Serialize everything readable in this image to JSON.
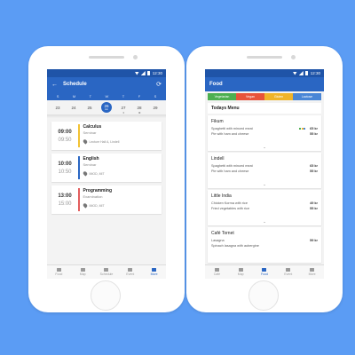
{
  "status": {
    "time": "12:30"
  },
  "schedule": {
    "title": "Schedule",
    "weekdays": [
      "S",
      "M",
      "T",
      "W",
      "T",
      "F",
      "S"
    ],
    "dates": [
      "23",
      "24",
      "25",
      "26",
      "27",
      "28",
      "29"
    ],
    "selected_sub": "Jun",
    "events": [
      {
        "start": "09:00",
        "end": "09:50",
        "subject": "Calculus",
        "kind": "Seminar",
        "location": "Lecture Hall A, Lindell",
        "color": "#f2c233"
      },
      {
        "start": "10:00",
        "end": "10:50",
        "subject": "English",
        "kind": "Seminar",
        "location": "IMOD, MIT",
        "color": "#2a66c3"
      },
      {
        "start": "13:00",
        "end": "15:00",
        "subject": "Programming",
        "kind": "Examination",
        "location": "IMOD, MIT",
        "color": "#e35d5d"
      }
    ]
  },
  "food": {
    "title": "Food",
    "tags": [
      {
        "label": "Vegetarian",
        "color": "#4caf50"
      },
      {
        "label": "Vegan",
        "color": "#e8533a"
      },
      {
        "label": "Gluten",
        "color": "#f0b42a"
      },
      {
        "label": "Lactose",
        "color": "#4a86d6"
      }
    ],
    "menu_title": "Todays Menu",
    "restaurants": [
      {
        "name": "Fikum",
        "dishes": [
          {
            "name": "Spaghetti with minced meat",
            "price": "65 kr"
          },
          {
            "name": "Pie with ham and cheese",
            "price": "55 kr"
          }
        ]
      },
      {
        "name": "Lindell",
        "dishes": [
          {
            "name": "Spaghetti with minced meat",
            "price": "65 kr"
          },
          {
            "name": "Pie with ham and cheese",
            "price": "55 kr"
          }
        ]
      },
      {
        "name": "Little India",
        "dishes": [
          {
            "name": "Chicken Korma with rice",
            "price": "49 kr"
          },
          {
            "name": "Fried vegetables with rice",
            "price": "55 kr"
          }
        ]
      },
      {
        "name": "Café Tornet",
        "dishes": [
          {
            "name": "Lasagna",
            "price": "59 kr"
          },
          {
            "name": "Spinach lasagna with aubergine",
            "price": ""
          }
        ]
      }
    ]
  },
  "nav": {
    "left": [
      "Food",
      "Map",
      "Schedule",
      "Event",
      "More"
    ],
    "right": [
      "Café",
      "Map",
      "Food",
      "Event",
      "More"
    ]
  },
  "colors": {
    "primary": "#2a66c3",
    "status_bar": "#1f54a8",
    "background": "#5b9cf4"
  }
}
